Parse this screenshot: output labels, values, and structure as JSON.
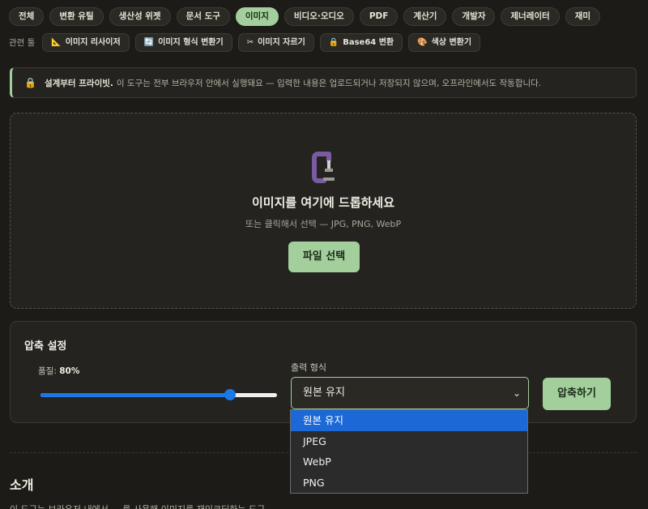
{
  "categories": [
    {
      "label": "전체",
      "active": false
    },
    {
      "label": "변환 유틸",
      "active": false
    },
    {
      "label": "생산성 위젯",
      "active": false
    },
    {
      "label": "문서 도구",
      "active": false
    },
    {
      "label": "이미지",
      "active": true
    },
    {
      "label": "비디오·오디오",
      "active": false
    },
    {
      "label": "PDF",
      "active": false
    },
    {
      "label": "계산기",
      "active": false
    },
    {
      "label": "개발자",
      "active": false
    },
    {
      "label": "제너레이터",
      "active": false
    },
    {
      "label": "재미",
      "active": false
    }
  ],
  "related": {
    "label": "관련 툴",
    "items": [
      {
        "icon": "ruler-icon",
        "glyph": "📐",
        "label": "이미지 리사이저"
      },
      {
        "icon": "convert-icon",
        "glyph": "🔄",
        "label": "이미지 형식 변환기"
      },
      {
        "icon": "scissors-icon",
        "glyph": "✂",
        "label": "이미지 자르기"
      },
      {
        "icon": "lock-icon",
        "glyph": "🔒",
        "label": "Base64 변환"
      },
      {
        "icon": "palette-icon",
        "glyph": "🎨",
        "label": "색상 변환기"
      }
    ]
  },
  "notice": {
    "lock_glyph": "🔒",
    "bold": "설계부터 프라이빗.",
    "text": "이 도구는 전부 브라우저 안에서 실행돼요 — 입력한 내용은 업로드되거나 저장되지 않으며, 오프라인에서도 작동합니다."
  },
  "dropzone": {
    "title": "이미지를 여기에 드롭하세요",
    "subtitle": "또는 클릭해서 선택 — JPG, PNG, WebP",
    "button": "파일 선택"
  },
  "settings": {
    "title": "압축 설정",
    "quality_label": "품질:",
    "quality_value_text": "80%",
    "quality_value": 0.8,
    "format_label": "출력 형식",
    "format_selected": "원본 유지",
    "compress_button": "압축하기"
  },
  "format_options": [
    {
      "label": "원본 유지",
      "selected": true
    },
    {
      "label": "JPEG",
      "selected": false
    },
    {
      "label": "WebP",
      "selected": false
    },
    {
      "label": "PNG",
      "selected": false
    }
  ],
  "intro": {
    "title": "소개",
    "text": "이 도구는 브라우저 내에서 ... 를 사용해 이미지를 재인코딩하는 도구"
  },
  "colors": {
    "accent": "#a3cf9c",
    "slider": "#1b78e6",
    "background": "#1c1b17",
    "selected_option": "#1b68d6"
  }
}
